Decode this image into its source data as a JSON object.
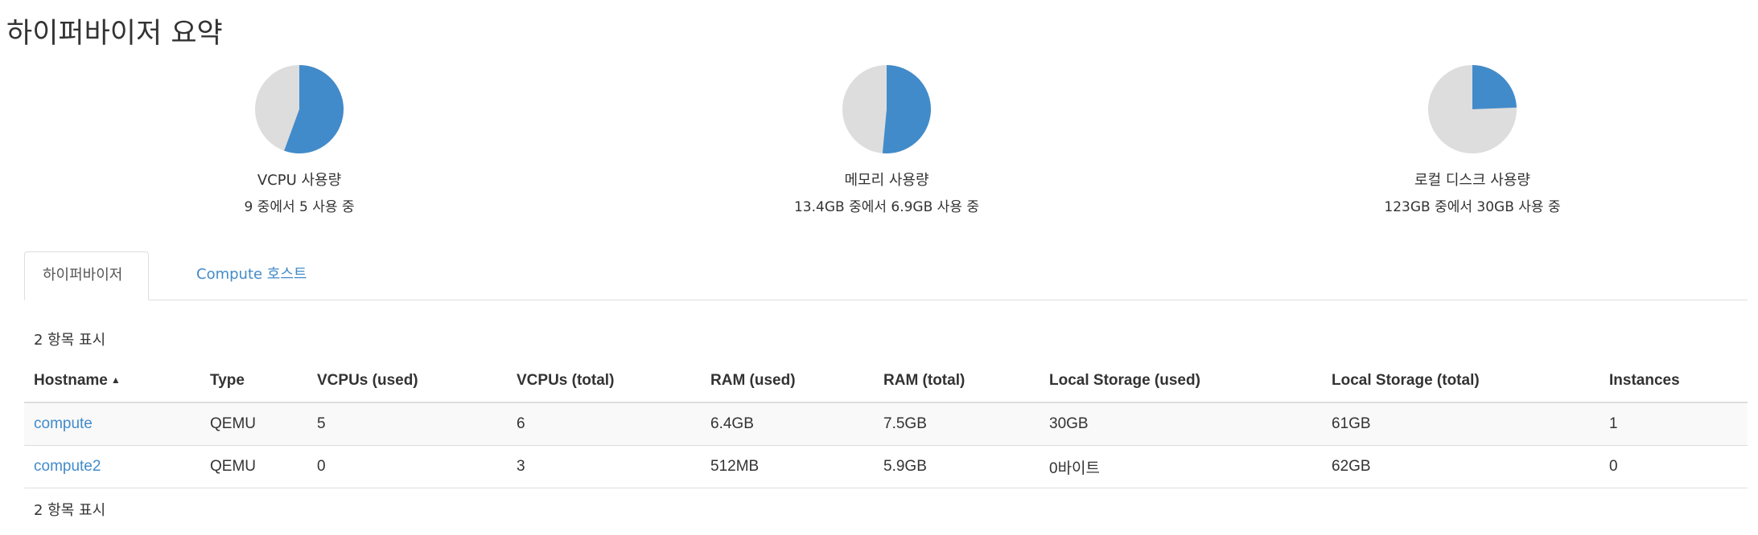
{
  "page": {
    "title": "하이퍼바이저 요약"
  },
  "summary": [
    {
      "label": "VCPU 사용량",
      "detail": "9 중에서 5 사용 중",
      "used_fraction": 0.5556,
      "used_color": "#428bca",
      "free_color": "#dddddd"
    },
    {
      "label": "메모리 사용량",
      "detail": "13.4GB 중에서 6.9GB 사용 중",
      "used_fraction": 0.5149,
      "used_color": "#428bca",
      "free_color": "#dddddd"
    },
    {
      "label": "로컬 디스크 사용량",
      "detail": "123GB 중에서 30GB 사용 중",
      "used_fraction": 0.2439,
      "used_color": "#428bca",
      "free_color": "#dddddd"
    }
  ],
  "tabs": [
    {
      "label": "하이퍼바이저",
      "active": true
    },
    {
      "label": "Compute 호스트",
      "active": false
    }
  ],
  "table": {
    "count_top": "2 항목 표시",
    "count_bottom": "2 항목 표시",
    "sort_icon": "caret-up-icon",
    "columns": [
      "Hostname",
      "Type",
      "VCPUs (used)",
      "VCPUs (total)",
      "RAM (used)",
      "RAM (total)",
      "Local Storage (used)",
      "Local Storage (total)",
      "Instances"
    ],
    "rows": [
      [
        "compute",
        "QEMU",
        "5",
        "6",
        "6.4GB",
        "7.5GB",
        "30GB",
        "61GB",
        "1"
      ],
      [
        "compute2",
        "QEMU",
        "0",
        "3",
        "512MB",
        "5.9GB",
        "0바이트",
        "62GB",
        "0"
      ]
    ]
  },
  "colors": {
    "link": "#428bca",
    "text": "#333333",
    "border": "#dddddd"
  }
}
